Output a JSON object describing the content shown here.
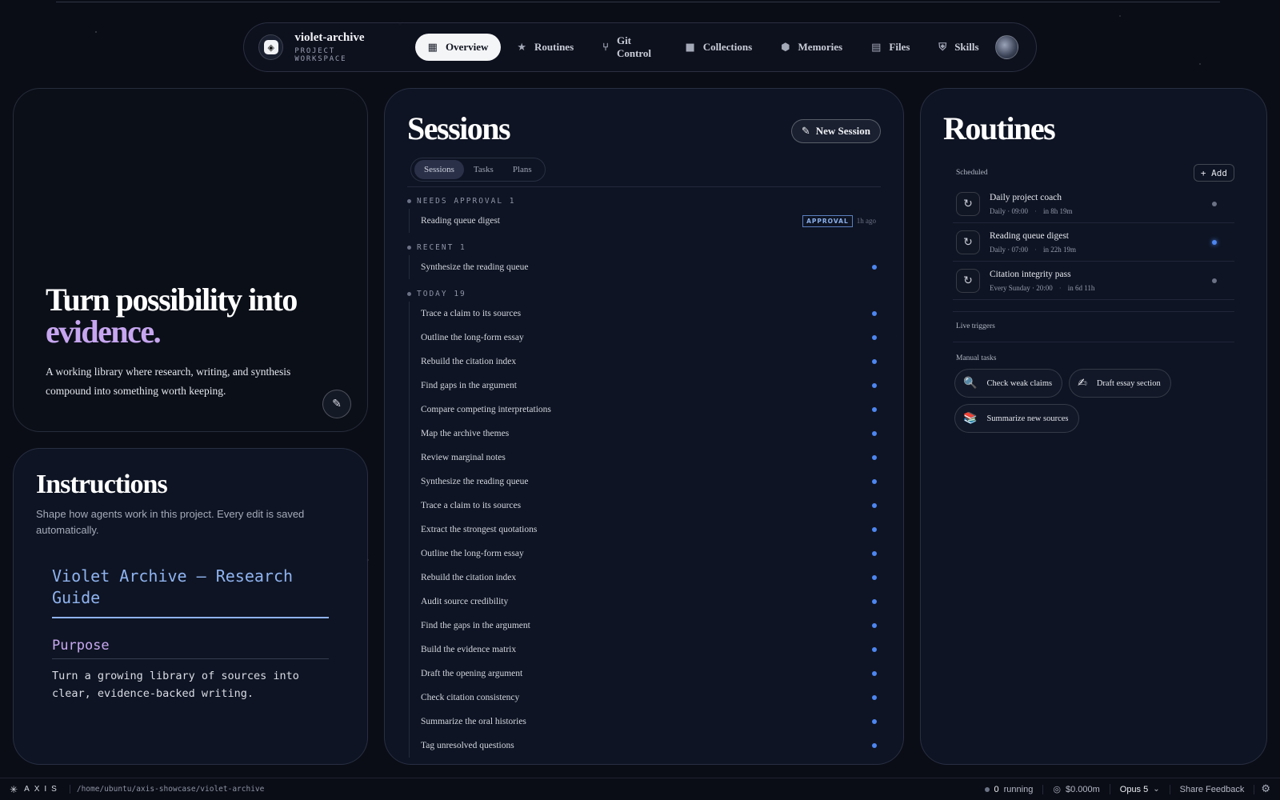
{
  "nav": {
    "brand_name": "violet-archive",
    "brand_sub": "PROJECT WORKSPACE",
    "items": [
      {
        "label": "Overview",
        "icon": "grid-icon",
        "glyph": "▦",
        "active": true
      },
      {
        "label": "Routines",
        "icon": "star-icon",
        "glyph": "★",
        "active": false
      },
      {
        "label": "Git Control",
        "icon": "git-branch-icon",
        "glyph": "⑂",
        "active": false
      },
      {
        "label": "Collections",
        "icon": "folder-icon",
        "glyph": "■",
        "active": false
      },
      {
        "label": "Memories",
        "icon": "brain-icon",
        "glyph": "⬢",
        "active": false
      },
      {
        "label": "Files",
        "icon": "file-icon",
        "glyph": "▤",
        "active": false
      },
      {
        "label": "Skills",
        "icon": "shield-check-icon",
        "glyph": "⛨",
        "active": false
      }
    ]
  },
  "hero": {
    "title_line1": "Turn possibility into",
    "title_accent": "evidence.",
    "description": "A working library where research, writing, and synthesis compound into something worth keeping."
  },
  "instructions": {
    "title": "Instructions",
    "subtitle": "Shape how agents work in this project. Every edit is saved automatically.",
    "doc_title": "Violet Archive — Research Guide",
    "doc_heading": "Purpose",
    "doc_body": "Turn a growing library of sources into clear, evidence-backed writing."
  },
  "sessions": {
    "title": "Sessions",
    "new_button": "New Session",
    "tabs": [
      "Sessions",
      "Tasks",
      "Plans"
    ],
    "groups": [
      {
        "header": "NEEDS APPROVAL 1",
        "rows": [
          {
            "label": "Reading queue digest",
            "badge": "APPROVAL",
            "ago": "1h ago"
          }
        ]
      },
      {
        "header": "RECENT 1",
        "rows": [
          {
            "label": "Synthesize the reading queue"
          }
        ]
      },
      {
        "header": "TODAY 19",
        "rows": [
          {
            "label": "Trace a claim to its sources"
          },
          {
            "label": "Outline the long-form essay"
          },
          {
            "label": "Rebuild the citation index"
          },
          {
            "label": "Find gaps in the argument"
          },
          {
            "label": "Compare competing interpretations"
          },
          {
            "label": "Map the archive themes"
          },
          {
            "label": "Review marginal notes"
          },
          {
            "label": "Synthesize the reading queue"
          },
          {
            "label": "Trace a claim to its sources"
          },
          {
            "label": "Extract the strongest quotations"
          },
          {
            "label": "Outline the long-form essay"
          },
          {
            "label": "Rebuild the citation index"
          },
          {
            "label": "Audit source credibility"
          },
          {
            "label": "Find the gaps in the argument"
          },
          {
            "label": "Build the evidence matrix"
          },
          {
            "label": "Draft the opening argument"
          },
          {
            "label": "Check citation consistency"
          },
          {
            "label": "Summarize the oral histories"
          },
          {
            "label": "Tag unresolved questions"
          }
        ]
      }
    ]
  },
  "routines": {
    "title": "Routines",
    "scheduled_label": "Scheduled",
    "add_label": "+ Add",
    "items": [
      {
        "name": "Daily project coach",
        "schedule": "Daily · 09:00",
        "next": "in 8h 19m",
        "active": false
      },
      {
        "name": "Reading queue digest",
        "schedule": "Daily · 07:00",
        "next": "in 22h 19m",
        "active": true
      },
      {
        "name": "Citation integrity pass",
        "schedule": "Every Sunday · 20:00",
        "next": "in 6d 11h",
        "active": false
      }
    ],
    "live_triggers_label": "Live triggers",
    "manual_tasks_label": "Manual tasks",
    "manual_tasks": [
      {
        "emoji": "🔍",
        "icon": "magnifier-icon",
        "label": "Check weak claims"
      },
      {
        "emoji": "✍",
        "icon": "writing-hand-icon",
        "label": "Draft essay section"
      },
      {
        "emoji": "📚",
        "icon": "books-icon",
        "label": "Summarize new sources"
      }
    ]
  },
  "footer": {
    "brand": "AXIS",
    "path": "/home/ubuntu/axis-showcase/violet-archive",
    "running_count": "0",
    "running_label": "running",
    "cost": "$0.000m",
    "model": "Opus 5",
    "feedback": "Share Feedback"
  },
  "colors": {
    "accent_violet": "#c7a6f0",
    "accent_blue": "#4d86f0",
    "background": "#0a0d16"
  }
}
